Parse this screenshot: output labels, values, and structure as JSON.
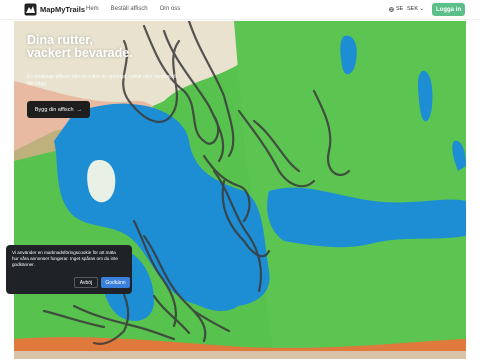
{
  "nav": {
    "brand": "MapMyTrails",
    "links": [
      "Hem",
      "Beställ affisch",
      "Om oss"
    ],
    "language": "SE",
    "currency": "SEK",
    "login": "Logga in"
  },
  "hero": {
    "title": "Dina rutter, vackert bevarade.",
    "subtitle": "En heatmap-affisch från de rutter du sprungit, cyklat eller vandrat till din vägg.",
    "cta": "Bygg din affisch",
    "cta_arrow": "→"
  },
  "cookie": {
    "text": "Vi använder en marknadsföringscookie för att mäta hur våra annonser fungerar. Inget spåras om du inte godkänner.",
    "decline": "Avböj",
    "accept": "Godkänn"
  },
  "colors": {
    "accent": "#5bbf8a",
    "water": "#1f8fd6",
    "land": "#4fc04a",
    "accept": "#3a7fd9"
  },
  "icons": {
    "logo": "map-logo-icon",
    "globe": "globe-icon",
    "chevron": "chevron-down-icon"
  }
}
